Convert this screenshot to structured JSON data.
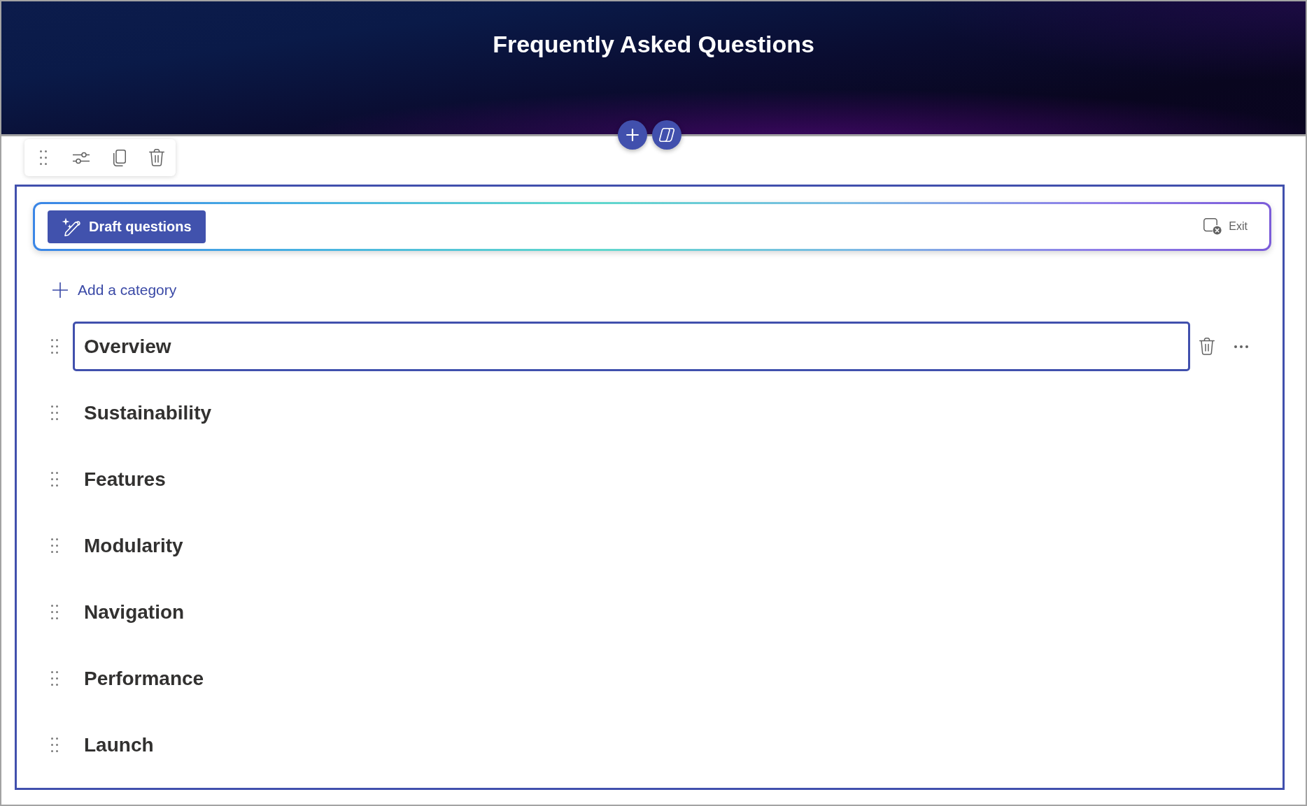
{
  "header": {
    "title": "Frequently Asked Questions"
  },
  "draft_bar": {
    "draft_button": "Draft questions",
    "exit_button": "Exit"
  },
  "add_category": "Add a category",
  "categories": [
    {
      "label": "Overview",
      "selected": true
    },
    {
      "label": "Sustainability",
      "selected": false
    },
    {
      "label": "Features",
      "selected": false
    },
    {
      "label": "Modularity",
      "selected": false
    },
    {
      "label": "Navigation",
      "selected": false
    },
    {
      "label": "Performance",
      "selected": false
    },
    {
      "label": "Launch",
      "selected": false
    }
  ]
}
